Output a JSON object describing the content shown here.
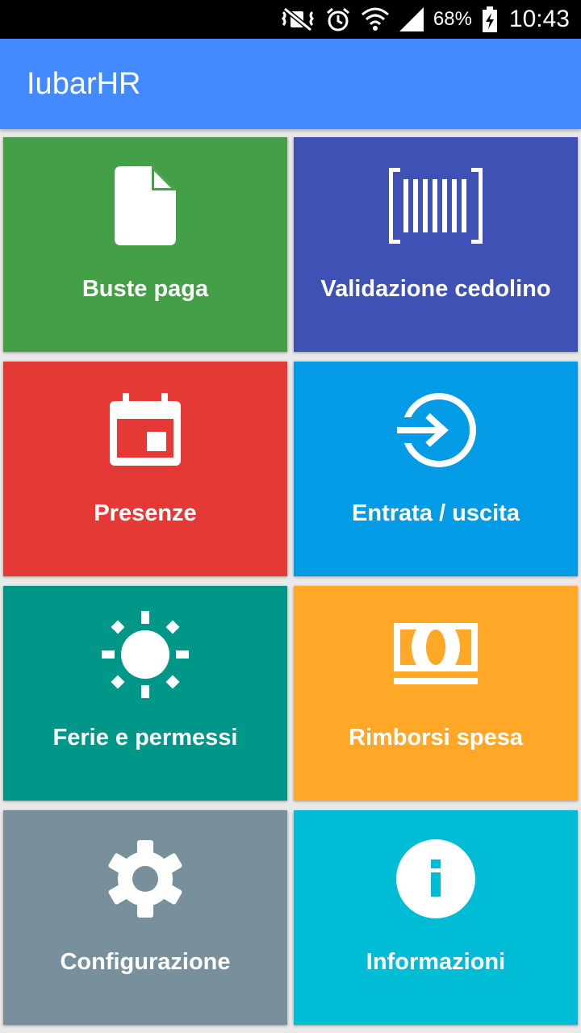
{
  "status_bar": {
    "battery_percent": "68%",
    "time": "10:43",
    "icons": [
      "mute-icon",
      "alarm-icon",
      "wifi-icon",
      "signal-icon",
      "battery-charging-icon"
    ]
  },
  "app_bar": {
    "title": "IubarHR",
    "color": "#448aff"
  },
  "tiles": [
    {
      "label": "Buste paga",
      "icon": "document-icon",
      "color": "#43a047"
    },
    {
      "label": "Validazione cedolino",
      "icon": "barcode-scan-icon",
      "color": "#3f51b5"
    },
    {
      "label": "Presenze",
      "icon": "calendar-icon",
      "color": "#e53935"
    },
    {
      "label": "Entrata / uscita",
      "icon": "enter-icon",
      "color": "#039be5"
    },
    {
      "label": "Ferie e permessi",
      "icon": "sun-icon",
      "color": "#009688"
    },
    {
      "label": "Rimborsi spesa",
      "icon": "money-icon",
      "color": "#ffa726"
    },
    {
      "label": "Configurazione",
      "icon": "gear-icon",
      "color": "#78909c"
    },
    {
      "label": "Informazioni",
      "icon": "info-icon",
      "color": "#00bcd4"
    }
  ]
}
